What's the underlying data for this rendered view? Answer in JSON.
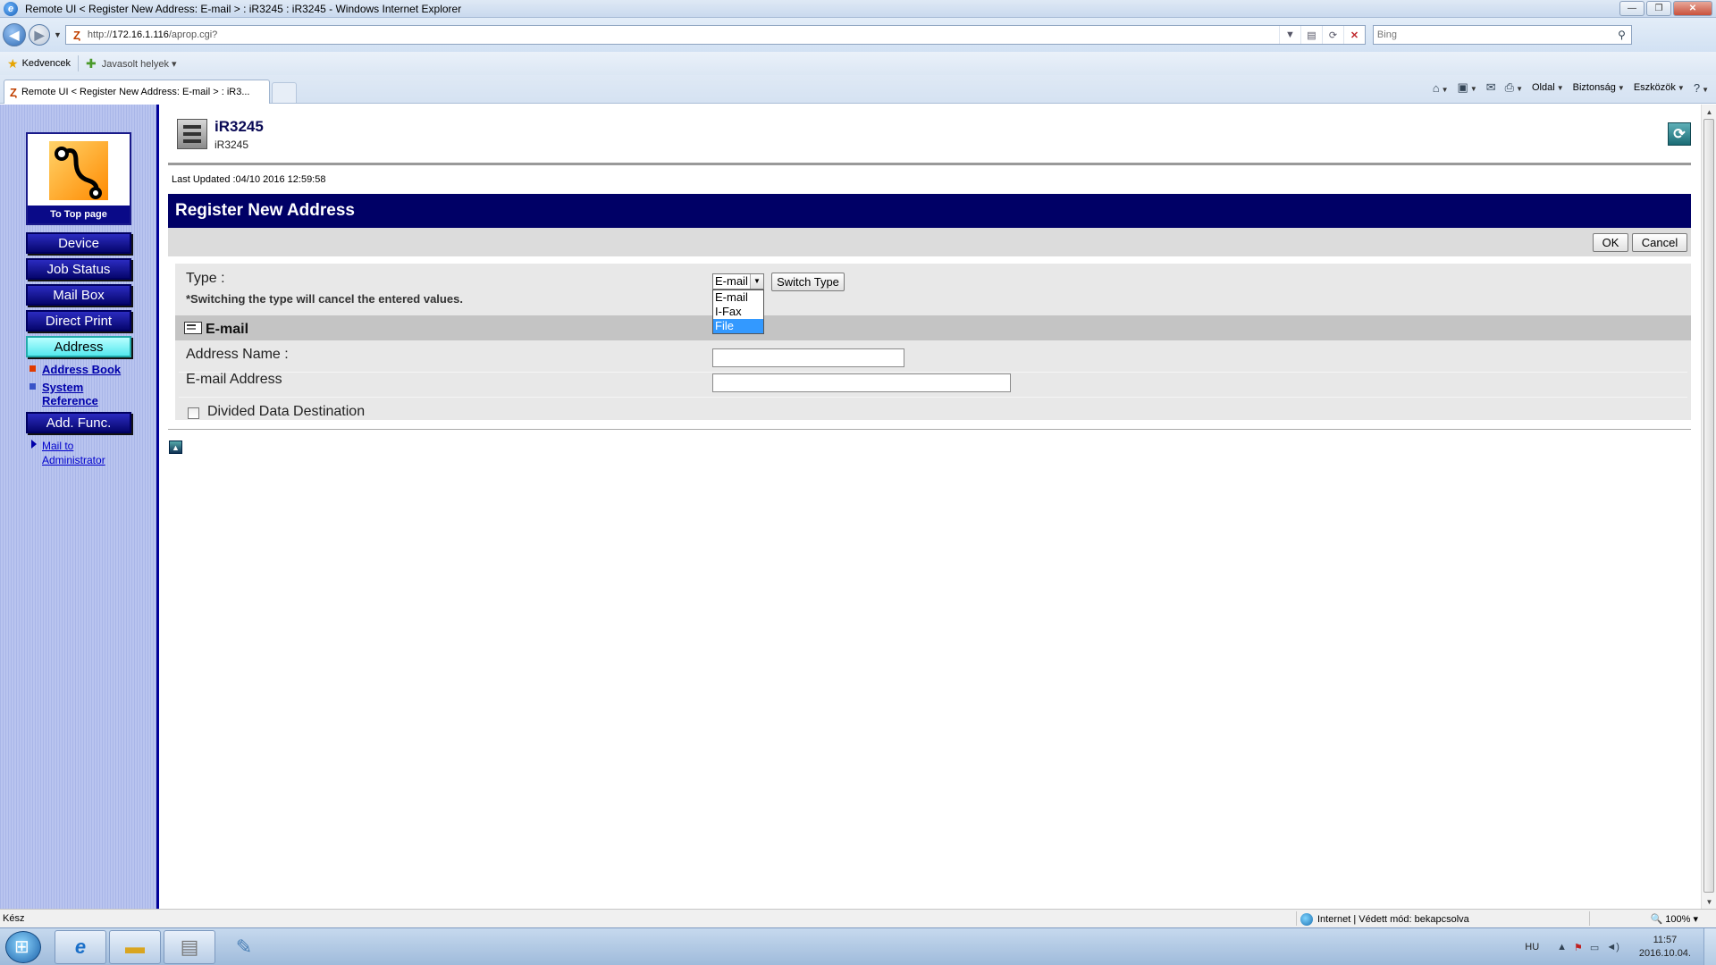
{
  "window": {
    "title": "Remote UI < Register New Address: E-mail > : iR3245 : iR3245 - Windows Internet Explorer"
  },
  "browser": {
    "url_prefix": "http://",
    "url_host": "172.16.1.116",
    "url_path": "/aprop.cgi?",
    "search_placeholder": "Bing",
    "favorites_label": "Kedvencek",
    "suggested_sites_label": "Javasolt helyek",
    "tab_title": "Remote UI < Register New Address: E-mail > : iR3...",
    "commands": {
      "page": "Oldal",
      "safety": "Biztonság",
      "tools": "Eszközök"
    }
  },
  "sidebar": {
    "top_page_label": "To Top page",
    "buttons": [
      {
        "label": "Device",
        "active": false
      },
      {
        "label": "Job Status",
        "active": false
      },
      {
        "label": "Mail Box",
        "active": false
      },
      {
        "label": "Direct Print",
        "active": false
      },
      {
        "label": "Address",
        "active": true
      },
      {
        "label": "Add. Func.",
        "active": false
      }
    ],
    "sublinks": {
      "address_book": "Address Book",
      "system_reference_1": "System",
      "system_reference_2": "Reference"
    },
    "mail_admin_1": "Mail to",
    "mail_admin_2": "Administrator"
  },
  "device": {
    "name": "iR3245",
    "model": "iR3245",
    "last_updated": "Last Updated :04/10 2016 12:59:58"
  },
  "page": {
    "title": "Register New Address",
    "ok_label": "OK",
    "cancel_label": "Cancel"
  },
  "form": {
    "type_label": "Type :",
    "type_note": "*Switching the type will cancel the entered values.",
    "type_selected": "E-mail",
    "type_options": [
      "E-mail",
      "I-Fax",
      "File"
    ],
    "highlighted_option": "File",
    "switch_type_label": "Switch Type",
    "section_title": "E-mail",
    "address_name_label": "Address Name :",
    "address_name_value": "",
    "email_address_label": "E-mail Address",
    "email_address_value": "",
    "divided_data_label": "Divided Data Destination",
    "divided_data_checked": false
  },
  "statusbar": {
    "status": "Kész",
    "zone": "Internet | Védett mód: bekapcsolva",
    "zoom": "100%"
  },
  "taskbar": {
    "language": "HU",
    "time": "11:57",
    "date": "2016.10.04."
  }
}
